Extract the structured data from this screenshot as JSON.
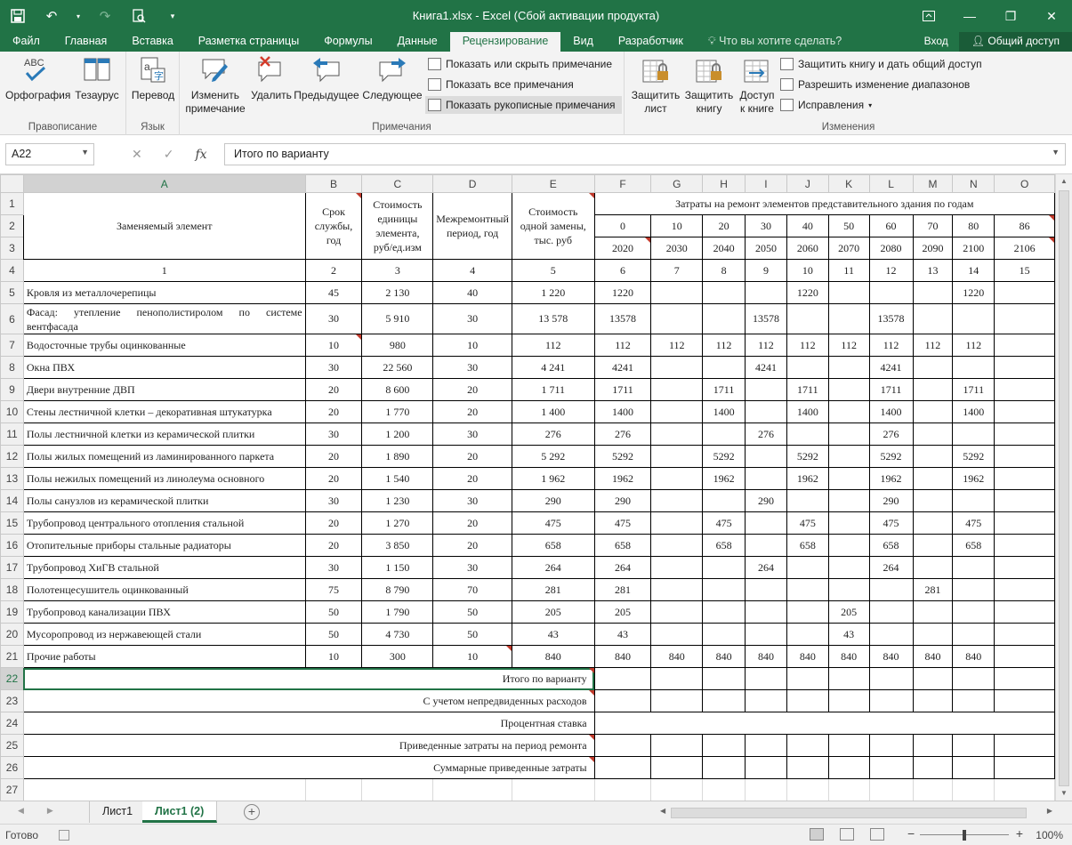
{
  "window": {
    "title": "Книга1.xlsx - Excel (Сбой активации продукта)"
  },
  "ribbon_tabs": [
    "Файл",
    "Главная",
    "Вставка",
    "Разметка страницы",
    "Формулы",
    "Данные",
    "Рецензирование",
    "Вид",
    "Разработчик"
  ],
  "active_tab": "Рецензирование",
  "tell_me": "Что вы хотите сделать?",
  "login": "Вход",
  "share": "Общий доступ",
  "ribbon": {
    "spelling": "Орфография",
    "thesaurus": "Тезаурус",
    "group_proofing": "Правописание",
    "translate": "Перевод",
    "group_language": "Язык",
    "edit_comment_1": "Изменить",
    "edit_comment_2": "примечание",
    "delete": "Удалить",
    "previous": "Предыдущее",
    "next": "Следующее",
    "show_hide_comment": "Показать или скрыть примечание",
    "show_all_comments": "Показать все примечания",
    "show_ink": "Показать рукописные примечания",
    "group_comments": "Примечания",
    "protect_sheet_1": "Защитить",
    "protect_sheet_2": "лист",
    "protect_book_1": "Защитить",
    "protect_book_2": "книгу",
    "access_book_1": "Доступ",
    "access_book_2": "к книге",
    "protect_share": "Защитить книгу и дать общий доступ",
    "allow_ranges": "Разрешить изменение диапазонов",
    "track_changes": "Исправления",
    "group_changes": "Изменения"
  },
  "formula_bar": {
    "name_box": "A22",
    "fx": "fx",
    "value": "Итого по варианту"
  },
  "columns": [
    "A",
    "B",
    "C",
    "D",
    "E",
    "F",
    "G",
    "H",
    "I",
    "J",
    "K",
    "L",
    "M",
    "N",
    "O"
  ],
  "table": {
    "header": {
      "element": "Заменяемый элемент",
      "service_life": "Срок службы, год",
      "unit_cost": "Стоимость единицы элемента, руб/ед.изм",
      "repair_period": "Межремонтный период, год",
      "replacement_cost": "Стоимость одной замены, тыс. руб",
      "costs_by_year": "Затраты на ремонт элементов представительного здания по годам",
      "offsets": [
        "0",
        "10",
        "20",
        "30",
        "40",
        "50",
        "60",
        "70",
        "80",
        "86"
      ],
      "years": [
        "2020",
        "2030",
        "2040",
        "2050",
        "2060",
        "2070",
        "2080",
        "2090",
        "2100",
        "2106"
      ],
      "col_numbers": [
        "1",
        "2",
        "3",
        "4",
        "5",
        "6",
        "7",
        "8",
        "9",
        "10",
        "11",
        "12",
        "13",
        "14",
        "15"
      ]
    },
    "rows": [
      {
        "name": "Кровля из металлочерепицы",
        "life": "45",
        "unit": "2 130",
        "period": "40",
        "cost": "1 220",
        "y": [
          "1220",
          "",
          "",
          "",
          "1220",
          "",
          "",
          "",
          "1220",
          ""
        ]
      },
      {
        "name": "Фасад: утепление пенополистиролом по системе вентфасада",
        "life": "30",
        "unit": "5 910",
        "period": "30",
        "cost": "13 578",
        "y": [
          "13578",
          "",
          "",
          "13578",
          "",
          "",
          "13578",
          "",
          "",
          ""
        ]
      },
      {
        "name": "Водосточные трубы оцинкованные",
        "life": "10",
        "unit": "980",
        "period": "10",
        "cost": "112",
        "y": [
          "112",
          "112",
          "112",
          "112",
          "112",
          "112",
          "112",
          "112",
          "112",
          ""
        ]
      },
      {
        "name": "Окна ПВХ",
        "life": "30",
        "unit": "22 560",
        "period": "30",
        "cost": "4 241",
        "y": [
          "4241",
          "",
          "",
          "4241",
          "",
          "",
          "4241",
          "",
          "",
          ""
        ]
      },
      {
        "name": "Двери внутренние ДВП",
        "life": "20",
        "unit": "8 600",
        "period": "20",
        "cost": "1 711",
        "y": [
          "1711",
          "",
          "1711",
          "",
          "1711",
          "",
          "1711",
          "",
          "1711",
          ""
        ]
      },
      {
        "name": "Стены лестничной клетки – декоративная штукатурка",
        "life": "20",
        "unit": "1 770",
        "period": "20",
        "cost": "1 400",
        "y": [
          "1400",
          "",
          "1400",
          "",
          "1400",
          "",
          "1400",
          "",
          "1400",
          ""
        ]
      },
      {
        "name": "Полы лестничной клетки из керамической плитки",
        "life": "30",
        "unit": "1 200",
        "period": "30",
        "cost": "276",
        "y": [
          "276",
          "",
          "",
          "276",
          "",
          "",
          "276",
          "",
          "",
          ""
        ]
      },
      {
        "name": "Полы жилых помещений из ламинированного паркета",
        "life": "20",
        "unit": "1 890",
        "period": "20",
        "cost": "5 292",
        "y": [
          "5292",
          "",
          "5292",
          "",
          "5292",
          "",
          "5292",
          "",
          "5292",
          ""
        ]
      },
      {
        "name": "Полы нежилых помещений из линолеума основного",
        "life": "20",
        "unit": "1 540",
        "period": "20",
        "cost": "1 962",
        "y": [
          "1962",
          "",
          "1962",
          "",
          "1962",
          "",
          "1962",
          "",
          "1962",
          ""
        ]
      },
      {
        "name": "Полы санузлов из керамической плитки",
        "life": "30",
        "unit": "1 230",
        "period": "30",
        "cost": "290",
        "y": [
          "290",
          "",
          "",
          "290",
          "",
          "",
          "290",
          "",
          "",
          ""
        ]
      },
      {
        "name": "Трубопровод центрального отопления стальной",
        "life": "20",
        "unit": "1 270",
        "period": "20",
        "cost": "475",
        "y": [
          "475",
          "",
          "475",
          "",
          "475",
          "",
          "475",
          "",
          "475",
          ""
        ]
      },
      {
        "name": "Отопительные приборы стальные радиаторы",
        "life": "20",
        "unit": "3 850",
        "period": "20",
        "cost": "658",
        "y": [
          "658",
          "",
          "658",
          "",
          "658",
          "",
          "658",
          "",
          "658",
          ""
        ]
      },
      {
        "name": "Трубопровод ХиГВ стальной",
        "life": "30",
        "unit": "1 150",
        "period": "30",
        "cost": "264",
        "y": [
          "264",
          "",
          "",
          "264",
          "",
          "",
          "264",
          "",
          "",
          ""
        ]
      },
      {
        "name": "Полотенцесушитель оцинкованный",
        "life": "75",
        "unit": "8 790",
        "period": "70",
        "cost": "281",
        "y": [
          "281",
          "",
          "",
          "",
          "",
          "",
          "",
          "281",
          "",
          ""
        ]
      },
      {
        "name": "Трубопровод канализации ПВХ",
        "life": "50",
        "unit": "1 790",
        "period": "50",
        "cost": "205",
        "y": [
          "205",
          "",
          "",
          "",
          "",
          "205",
          "",
          "",
          "",
          ""
        ]
      },
      {
        "name": "Мусоропровод из нержавеющей стали",
        "life": "50",
        "unit": "4 730",
        "period": "50",
        "cost": "43",
        "y": [
          "43",
          "",
          "",
          "",
          "",
          "43",
          "",
          "",
          "",
          ""
        ]
      },
      {
        "name": "Прочие работы",
        "life": "10",
        "unit": "300",
        "period": "10",
        "cost": "840",
        "y": [
          "840",
          "840",
          "840",
          "840",
          "840",
          "840",
          "840",
          "840",
          "840",
          ""
        ]
      }
    ],
    "summary": [
      "Итого по варианту",
      "С учетом непредвиденных расходов",
      "Процентная ставка",
      "Приведенные затраты на период ремонта",
      "Суммарные приведенные затраты"
    ]
  },
  "sheets": [
    "Лист1",
    "Лист1 (2)"
  ],
  "active_sheet": "Лист1 (2)",
  "status": {
    "ready": "Готово",
    "zoom": "100%"
  }
}
